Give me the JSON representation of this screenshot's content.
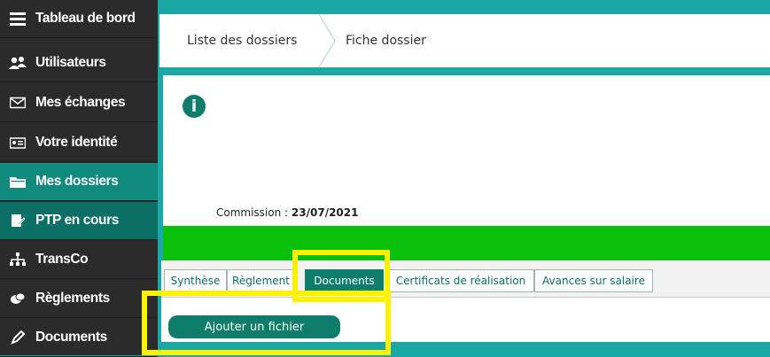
{
  "sidebar": {
    "items": [
      {
        "label": "Tableau de bord",
        "icon": "menu-icon"
      },
      {
        "label": "Utilisateurs",
        "icon": "users-icon"
      },
      {
        "label": "Mes échanges",
        "icon": "envelope-icon"
      },
      {
        "label": "Votre identité",
        "icon": "id-card-icon"
      },
      {
        "label": "Mes dossiers",
        "icon": "folder-icon"
      },
      {
        "label": "PTP en cours",
        "icon": "edit-document-icon"
      },
      {
        "label": "TransCo",
        "icon": "network-icon"
      },
      {
        "label": "Règlements",
        "icon": "coins-icon"
      },
      {
        "label": "Documents",
        "icon": "pen-icon"
      }
    ]
  },
  "breadcrumb": {
    "items": [
      "Liste des dossiers",
      "Fiche dossier"
    ]
  },
  "dossier": {
    "info_icon": "info-icon",
    "commission_label": "Commission :",
    "commission_date": "23/07/2021"
  },
  "tabs": [
    {
      "label": "Synthèse"
    },
    {
      "label": "Règlement"
    },
    {
      "label": "Documents"
    },
    {
      "label": "Certificats de réalisation"
    },
    {
      "label": "Avances sur salaire"
    }
  ],
  "documents": {
    "add_button_label": "Ajouter un fichier"
  },
  "colors": {
    "background_teal": "#1aa7a5",
    "sidebar_dark": "#2b2b2b",
    "accent_green": "#0f7d6b",
    "status_bar_green": "#09c10a",
    "highlight_yellow": "#fff200"
  }
}
